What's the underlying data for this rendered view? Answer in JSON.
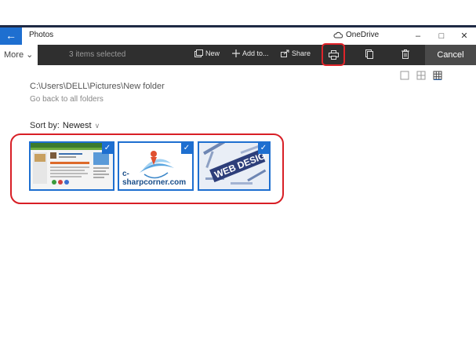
{
  "window": {
    "back_glyph": "←",
    "title": "Photos",
    "onedrive_label": "OneDrive",
    "minimize_glyph": "–",
    "maximize_glyph": "□",
    "close_glyph": "✕"
  },
  "left_menu": {
    "more_label": "More ⌄"
  },
  "command_bar": {
    "selection_text": "3 items selected",
    "new_label": "New",
    "add_to_label": "Add to...",
    "share_label": "Share",
    "cancel_label": "Cancel"
  },
  "folder": {
    "path": "C:\\Users\\DELL\\Pictures\\New folder",
    "back_link": "Go back to all folders"
  },
  "sort": {
    "label": "Sort by:",
    "value": "Newest",
    "chevron": "∨"
  },
  "thumbnails": [
    {
      "name": "screenshot-thumbnail",
      "checked": true,
      "check_glyph": "✓"
    },
    {
      "name": "c-sharpcorner-thumbnail",
      "checked": true,
      "check_glyph": "✓",
      "caption": "c-sharpcorner.com"
    },
    {
      "name": "web-design-thumbnail",
      "checked": true,
      "check_glyph": "✓",
      "art_text": "WEB DESIG"
    }
  ],
  "colors": {
    "accent": "#1e6fd0",
    "command_bar": "#2f2f2f",
    "highlight": "#d81f26"
  },
  "icons": [
    "back-arrow-icon",
    "cloud-icon",
    "new-album-icon",
    "add-icon",
    "share-icon",
    "print-icon",
    "copy-icon",
    "delete-icon",
    "single-view-icon",
    "grid-view-icon",
    "dense-grid-icon",
    "checkmark-icon"
  ]
}
